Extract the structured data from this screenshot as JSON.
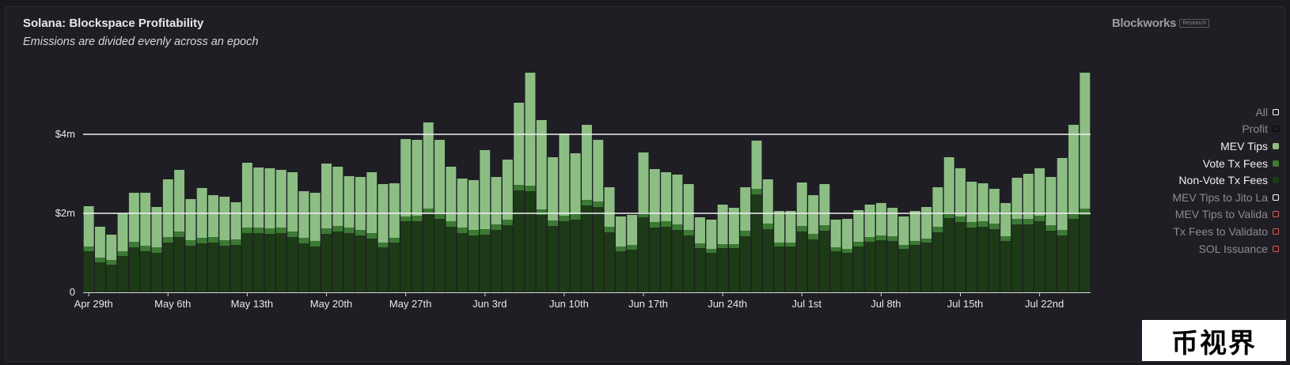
{
  "header": {
    "title": "Solana: Blockspace Profitability",
    "subtitle": "Emissions are divided evenly across an epoch"
  },
  "brand": {
    "name": "Blockworks",
    "tag": "Research"
  },
  "watermark": "币视界",
  "legend": [
    {
      "label": "All",
      "active": false,
      "box_style": "outline",
      "color": "#ffffff"
    },
    {
      "label": "Profit",
      "active": false,
      "box_style": "outline-dark",
      "color": "#000000"
    },
    {
      "label": "MEV Tips",
      "active": true,
      "box_style": "fill",
      "color": "#8cbe84"
    },
    {
      "label": "Vote Tx Fees",
      "active": true,
      "box_style": "fill",
      "color": "#3c7a34"
    },
    {
      "label": "Non-Vote Tx Fees",
      "active": true,
      "box_style": "fill",
      "color": "#1d3a17"
    },
    {
      "label": "MEV Tips to Jito La",
      "active": false,
      "box_style": "outline",
      "color": "#ffffff"
    },
    {
      "label": "MEV Tips to Valida",
      "active": false,
      "box_style": "outline",
      "color": "#e05a5a"
    },
    {
      "label": "Tx Fees to Validato",
      "active": false,
      "box_style": "outline",
      "color": "#e05a5a"
    },
    {
      "label": "SOL Issuance",
      "active": false,
      "box_style": "outline",
      "color": "#e05a5a"
    }
  ],
  "chart_data": {
    "type": "bar",
    "stacked": true,
    "title": "Solana: Blockspace Profitability",
    "subtitle": "Emissions are divided evenly across an epoch",
    "y_unit": "$M",
    "ylim": [
      0,
      6
    ],
    "y_ticks": [
      {
        "value": 0,
        "label": "0"
      },
      {
        "value": 2,
        "label": "$2m"
      },
      {
        "value": 4,
        "label": "$4m"
      }
    ],
    "x_ticks": [
      {
        "index": 0,
        "label": "Apr 29th"
      },
      {
        "index": 7,
        "label": "May 6th"
      },
      {
        "index": 14,
        "label": "May 13th"
      },
      {
        "index": 21,
        "label": "May 20th"
      },
      {
        "index": 28,
        "label": "May 27th"
      },
      {
        "index": 35,
        "label": "Jun 3rd"
      },
      {
        "index": 42,
        "label": "Jun 10th"
      },
      {
        "index": 49,
        "label": "Jun 17th"
      },
      {
        "index": 56,
        "label": "Jun 24th"
      },
      {
        "index": 63,
        "label": "Jul 1st"
      },
      {
        "index": 70,
        "label": "Jul 8th"
      },
      {
        "index": 77,
        "label": "Jul 15th"
      },
      {
        "index": 84,
        "label": "Jul 22nd"
      }
    ],
    "grid": "horizontal",
    "legend_position": "right",
    "series": [
      {
        "name": "Non-Vote Tx Fees",
        "color": "#1d3a17",
        "values": [
          1.04,
          0.76,
          0.7,
          0.92,
          1.14,
          1.04,
          1.0,
          1.26,
          1.4,
          1.18,
          1.24,
          1.26,
          1.18,
          1.2,
          1.5,
          1.5,
          1.48,
          1.5,
          1.4,
          1.24,
          1.16,
          1.48,
          1.54,
          1.5,
          1.44,
          1.36,
          1.14,
          1.26,
          1.8,
          1.8,
          1.98,
          1.86,
          1.66,
          1.5,
          1.44,
          1.46,
          1.58,
          1.7,
          2.58,
          2.56,
          1.96,
          1.68,
          1.8,
          1.84,
          2.2,
          2.16,
          1.52,
          1.04,
          1.08,
          1.9,
          1.64,
          1.66,
          1.58,
          1.44,
          1.12,
          1.0,
          1.12,
          1.12,
          1.42,
          2.48,
          1.6,
          1.16,
          1.16,
          1.54,
          1.34,
          1.56,
          1.04,
          1.0,
          1.16,
          1.28,
          1.32,
          1.3,
          1.1,
          1.2,
          1.26,
          1.52,
          1.88,
          1.78,
          1.64,
          1.66,
          1.6,
          1.3,
          1.72,
          1.72,
          1.8,
          1.56,
          1.44,
          1.86,
          1.96
        ]
      },
      {
        "name": "Vote Tx Fees",
        "color": "#3c7a34",
        "values": [
          0.12,
          0.12,
          0.12,
          0.12,
          0.14,
          0.14,
          0.14,
          0.14,
          0.14,
          0.14,
          0.14,
          0.14,
          0.14,
          0.14,
          0.14,
          0.14,
          0.14,
          0.14,
          0.14,
          0.14,
          0.14,
          0.14,
          0.14,
          0.14,
          0.14,
          0.14,
          0.12,
          0.12,
          0.12,
          0.14,
          0.14,
          0.14,
          0.14,
          0.14,
          0.14,
          0.14,
          0.14,
          0.14,
          0.14,
          0.14,
          0.14,
          0.14,
          0.14,
          0.14,
          0.14,
          0.14,
          0.14,
          0.12,
          0.12,
          0.12,
          0.14,
          0.14,
          0.14,
          0.14,
          0.12,
          0.1,
          0.1,
          0.1,
          0.14,
          0.14,
          0.14,
          0.1,
          0.1,
          0.14,
          0.14,
          0.14,
          0.1,
          0.1,
          0.12,
          0.12,
          0.12,
          0.12,
          0.1,
          0.1,
          0.1,
          0.14,
          0.14,
          0.14,
          0.14,
          0.14,
          0.14,
          0.12,
          0.14,
          0.14,
          0.14,
          0.14,
          0.14,
          0.14,
          0.16
        ]
      },
      {
        "name": "MEV Tips",
        "color": "#8cbe84",
        "values": [
          1.02,
          0.78,
          0.64,
          0.96,
          1.24,
          1.34,
          1.02,
          1.46,
          1.56,
          1.04,
          1.26,
          1.06,
          1.1,
          0.94,
          1.64,
          1.52,
          1.52,
          1.46,
          1.5,
          1.18,
          1.22,
          1.64,
          1.5,
          1.3,
          1.34,
          1.54,
          1.48,
          1.38,
          1.96,
          1.92,
          2.18,
          1.86,
          1.38,
          1.24,
          1.26,
          2.0,
          1.2,
          1.52,
          2.08,
          2.86,
          2.26,
          1.6,
          2.08,
          1.54,
          1.9,
          1.56,
          1.0,
          0.76,
          0.76,
          1.52,
          1.34,
          1.24,
          1.26,
          1.16,
          0.66,
          0.74,
          1.0,
          0.92,
          1.1,
          1.22,
          1.12,
          0.8,
          0.8,
          1.1,
          0.98,
          1.04,
          0.7,
          0.76,
          0.8,
          0.82,
          0.82,
          0.72,
          0.72,
          0.76,
          0.8,
          1.0,
          1.4,
          1.22,
          1.02,
          0.96,
          0.88,
          0.84,
          1.04,
          1.14,
          1.2,
          1.22,
          1.82,
          2.24,
          3.44
        ]
      }
    ]
  }
}
